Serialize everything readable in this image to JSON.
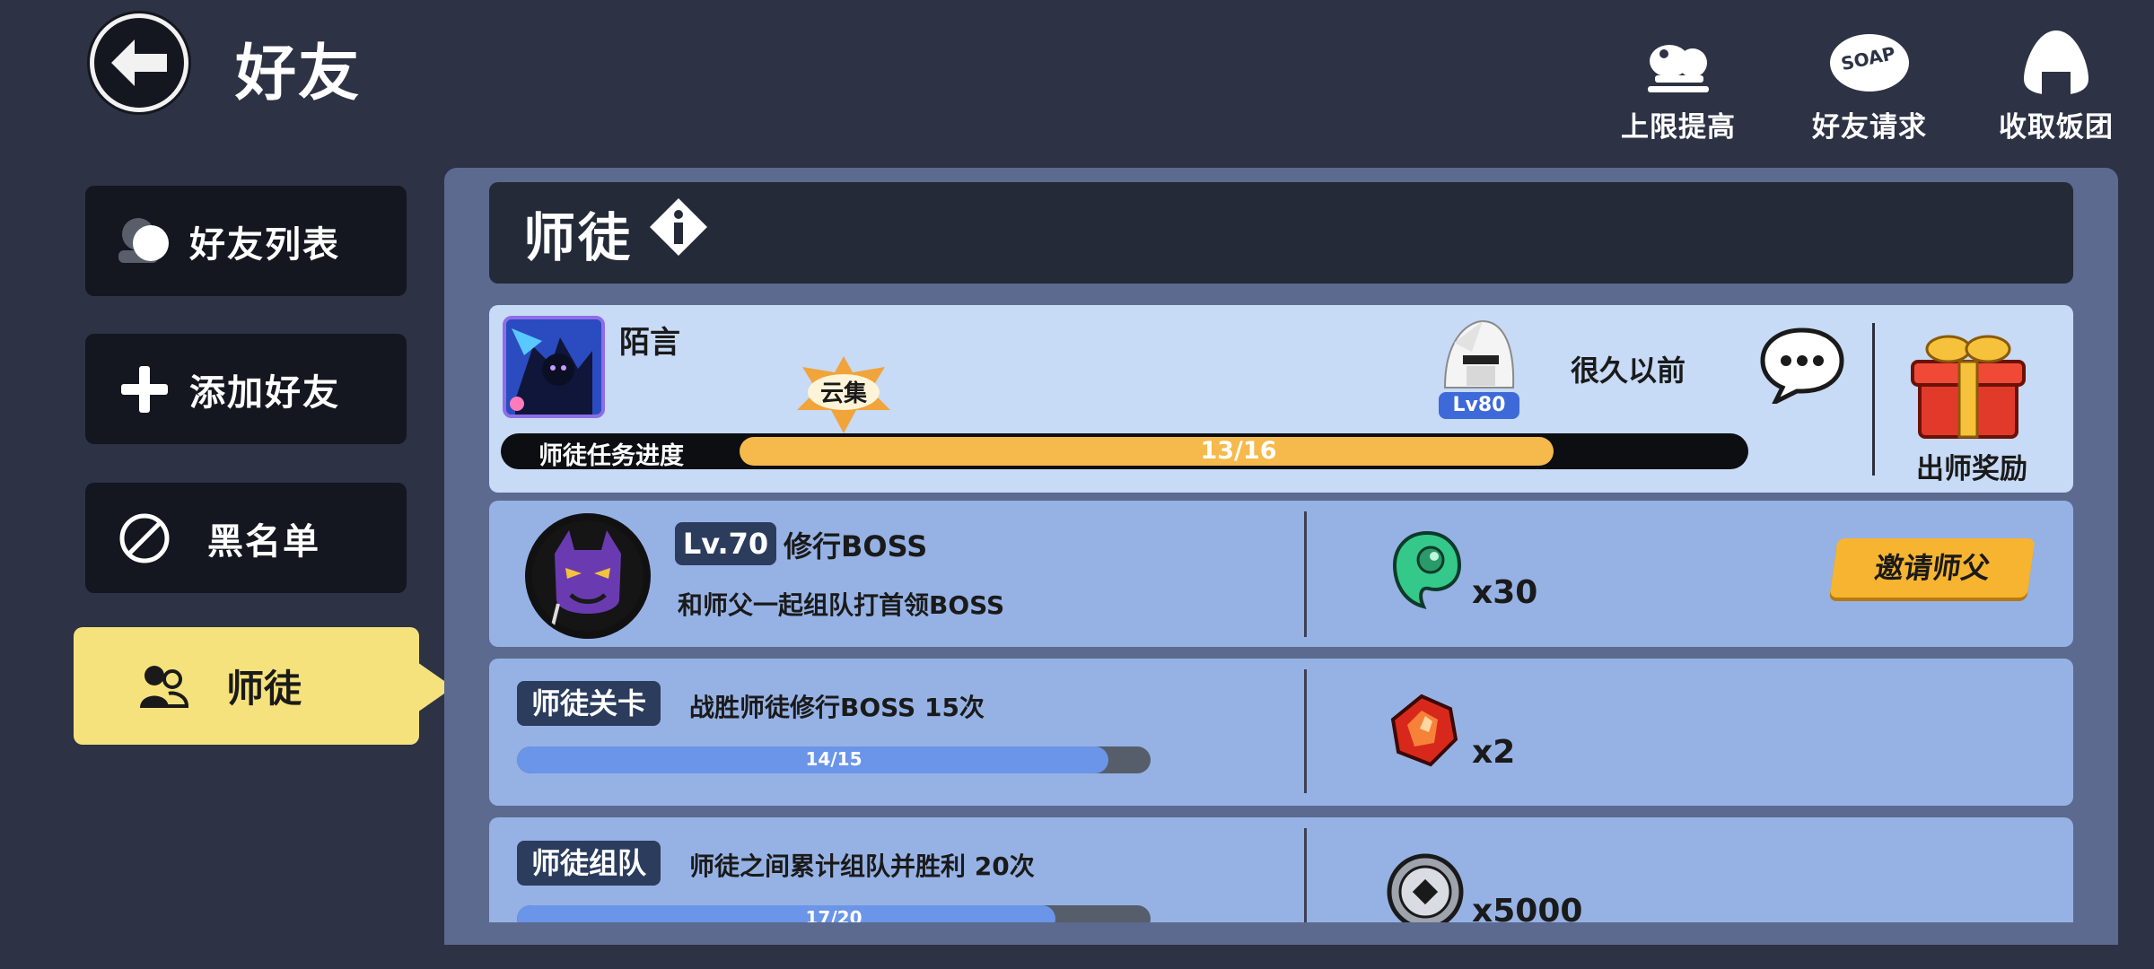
{
  "header": {
    "title": "好友",
    "actions": [
      {
        "label": "上限提高",
        "icon": "upgrade-icon"
      },
      {
        "label": "好友请求",
        "icon": "soap-bubble-icon",
        "icon_text": "SOAP"
      },
      {
        "label": "收取饭团",
        "icon": "rice-ball-icon"
      }
    ]
  },
  "sidebar": {
    "items": [
      {
        "label": "好友列表",
        "icon": "friends-icon"
      },
      {
        "label": "添加好友",
        "icon": "plus-icon"
      },
      {
        "label": "黑名单",
        "icon": "block-icon"
      },
      {
        "label": "师徒",
        "icon": "mentor-icon",
        "active": true
      }
    ]
  },
  "panel": {
    "title": "师徒",
    "info_icon": "info-icon"
  },
  "master": {
    "name": "陌言",
    "guild_badge": "云集",
    "level": "Lv80",
    "last_seen": "很久以前",
    "progress_label": "师徒任务进度",
    "progress_text": "13/16",
    "progress_fraction": 0.8125,
    "reward_label": "出师奖励"
  },
  "tasks": [
    {
      "level_tag": "Lv.70",
      "title": "修行BOSS",
      "description": "和师父一起组队打首领BOSS",
      "reward_icon": "green-spirit-icon",
      "reward_qty": "x30",
      "button": "邀请师父"
    },
    {
      "tag": "师徒关卡",
      "description": "战胜师徒修行BOSS 15次",
      "progress_text": "14/15",
      "progress_fraction": 0.933,
      "reward_icon": "red-gem-icon",
      "reward_qty": "x2"
    },
    {
      "tag": "师徒组队",
      "description": "师徒之间累计组队并胜利 20次",
      "progress_text": "17/20",
      "progress_fraction": 0.85,
      "reward_icon": "coin-icon",
      "reward_qty": "x5000"
    }
  ],
  "colors": {
    "background": "#2d3245",
    "panel": "#5b6a8e",
    "active_tab": "#f6e27c",
    "progress_orange": "#f6b94c",
    "progress_blue": "#6a95e8",
    "invite_button": "#f6b431"
  }
}
